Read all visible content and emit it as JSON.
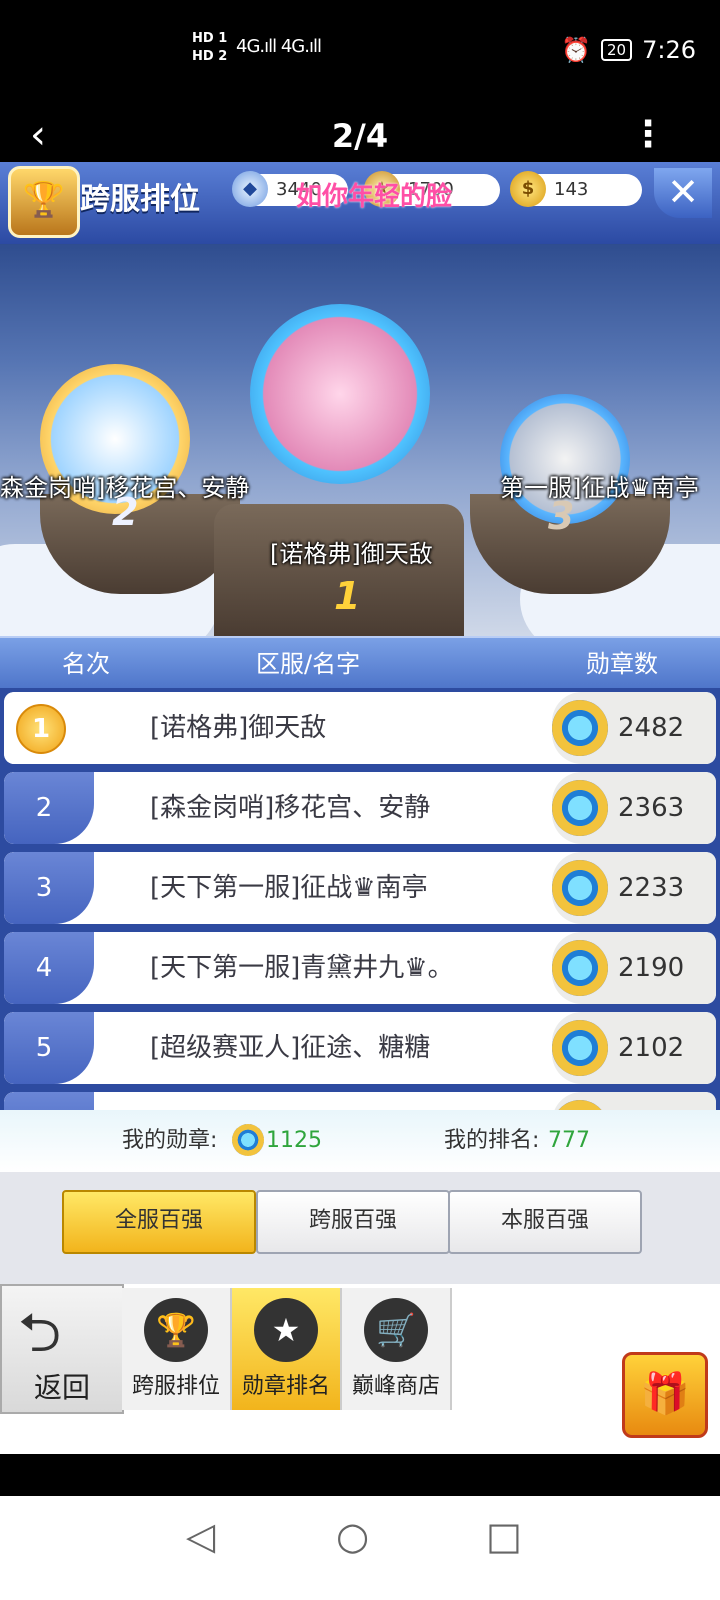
{
  "status_bar": {
    "net1": "HD 1",
    "net2": "HD 2",
    "signal": "4G.ıll 4G.ıll",
    "alarm_icon": "alarm-icon",
    "battery": "20",
    "time": "7:26"
  },
  "viewer": {
    "back_icon": "‹",
    "page": "2/4",
    "more_icon": "⋮"
  },
  "header": {
    "title": "跨服排位",
    "currency_diamond": "3440",
    "currency_star": "1700",
    "currency_coin": "143",
    "watermark": "如你年轻的脸"
  },
  "podium": {
    "first_label": "[诺格弗]御天敌",
    "first_rank": "1",
    "second_label": "森金岗哨]移花宫、安静",
    "second_rank": "2",
    "third_label": "第一服]征战♛南亭",
    "third_rank": "3"
  },
  "table": {
    "col_rank": "名次",
    "col_name": "区服/名字",
    "col_medals": "勋章数",
    "rows": [
      {
        "rank": "1",
        "name": "[诺格弗]御天敌",
        "score": "2482"
      },
      {
        "rank": "2",
        "name": "[森金岗哨]移花宫、安静",
        "score": "2363"
      },
      {
        "rank": "3",
        "name": "[天下第一服]征战♛南亭",
        "score": "2233"
      },
      {
        "rank": "4",
        "name": "[天下第一服]青黛井九♛。",
        "score": "2190"
      },
      {
        "rank": "5",
        "name": "[超级赛亚人]征途、糖糖",
        "score": "2102"
      }
    ]
  },
  "mine": {
    "medals_label": "我的勋章:",
    "medals_value": "1125",
    "rank_label": "我的排名:",
    "rank_value": "777"
  },
  "tabs": [
    "全服百强",
    "跨服百强",
    "本服百强"
  ],
  "bottom_nav": {
    "back_label": "返回",
    "items": [
      "跨服排位",
      "勋章排名",
      "巅峰商店"
    ]
  }
}
